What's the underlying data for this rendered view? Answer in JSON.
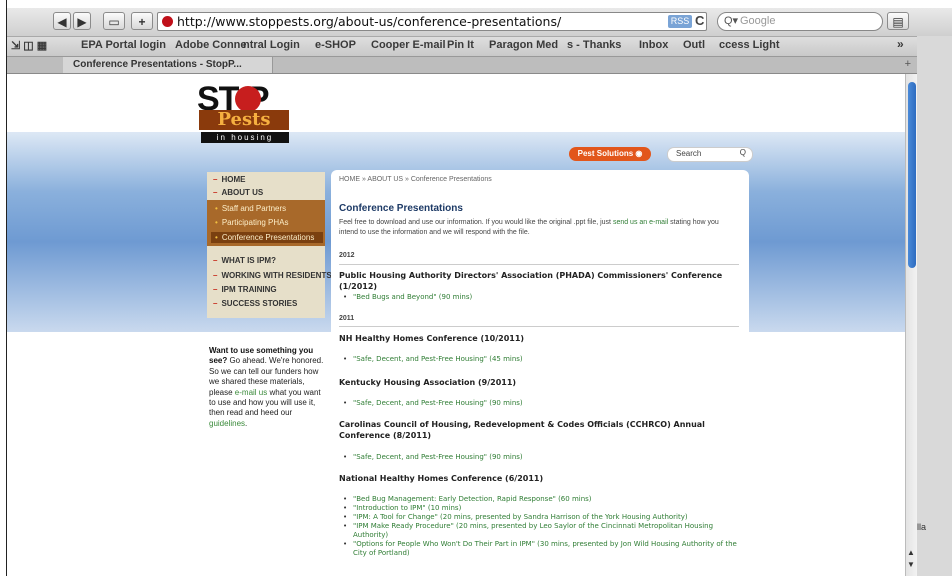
{
  "toolbar": {
    "back": "◀",
    "forward": "▶",
    "add": "+",
    "url": "http://www.stoppests.org/about-us/conference-presentations/",
    "rss": "RSS",
    "reload": "C",
    "search_placeholder": "Google",
    "search_icon": "Q▾"
  },
  "bookmarks": [
    "EPA Portal login",
    "Adobe Conne",
    "ntral Login",
    "e-SHOP",
    "Cooper E-mail",
    "Pin It",
    "Paragon Med",
    "s - Thanks",
    "Inbox",
    "Outl",
    "ccess Light"
  ],
  "bookmarks_more": "»",
  "tab": {
    "title": "Conference Presentations - StopP...",
    "new": "+"
  },
  "site": {
    "logo_stop": "ST  P",
    "logo_pests": "Pests",
    "logo_housing": "in housing",
    "pest_solutions": "Pest Solutions ◉",
    "search_label": "Search",
    "search_icon": "Q"
  },
  "nav": {
    "home": "HOME",
    "about": "ABOUT US",
    "sub": [
      "Staff and Partners",
      "Participating PHAs",
      "Conference Presentations"
    ],
    "what_ipm": "WHAT IS IPM?",
    "working": "WORKING WITH RESIDENTS",
    "training": "IPM TRAINING",
    "success": "SUCCESS STORIES"
  },
  "promo": {
    "title": "Want to use something you see?",
    "text1": " Go ahead. We're honored. So we can tell our funders how we shared these materials, please ",
    "link1": "e-mail us",
    "text2": " what you want to use and how you will use it, then read and heed our ",
    "link2": "guidelines",
    "end": "."
  },
  "content": {
    "breadcrumb": "HOME  »  ABOUT US  »  Conference Presentations",
    "title": "Conference Presentations",
    "intro1": "Feel free to download and use our information. If you would like the original .ppt file, just ",
    "intro_link": "send us an e-mail",
    "intro2": " stating how you intend to use the information and we will respond with the file.",
    "year2012": "2012",
    "conf1": "Public Housing Authority Directors' Association (PHADA) Commissioners' Conference (1/2012)",
    "conf1_items": [
      "\"Bed Bugs and Beyond\" (90 mins)"
    ],
    "year2011": "2011",
    "conf2": "NH Healthy Homes Conference (10/2011)",
    "conf2_items": [
      "\"Safe, Decent, and Pest-Free Housing\" (45 mins)"
    ],
    "conf3": "Kentucky Housing Association (9/2011)",
    "conf3_items": [
      "\"Safe, Decent, and Pest-Free Housing\" (90 mins)"
    ],
    "conf4": "Carolinas Council of Housing, Redevelopment & Codes Officials (CCHRCO) Annual Conference (8/2011)",
    "conf4_items": [
      "\"Safe, Decent, and Pest-Free Housing\" (90 mins)"
    ],
    "conf5": "National Healthy Homes Conference (6/2011)",
    "conf5_items": [
      "\"Bed Bug Management: Early Detection, Rapid Response\" (60 mins)",
      "\"Introduction to IPM\" (10 mins)",
      "\"IPM: A Tool for Change\" (20 mins, presented by Sandra Harrison of the York Housing Authority)",
      "\"IPM Make Ready Procedure\" (20 mins, presented by Leo Saylor of the Cincinnati Metropolitan Housing Authority)",
      "\"Options for People Who Won't Do Their Part in IPM\" (30 mins, presented by Jon Wild Housing Authority of the City of Portland)"
    ]
  },
  "side_label": "lla",
  "colors": {
    "accent_green": "#2f7d34",
    "nav_brown": "#a8692a",
    "title_blue": "#1d3a66",
    "pest_orange": "#e2561b"
  }
}
